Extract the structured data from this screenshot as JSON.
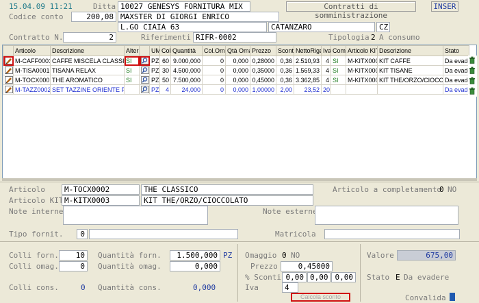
{
  "header": {
    "datetime": "15.04.09 11:21",
    "ditta_label": "Ditta",
    "ditta_value": "10027 GENESYS FORNITURA MIX",
    "contratti_button": "Contratti di somministrazione",
    "mode_badge": "INSER",
    "codice_conto_label": "Codice conto",
    "codice_conto_value": "200,08",
    "cliente_nome": "MAXSTER DI GIORGI ENRICO",
    "indirizzo": "L.GO CIAIA 63",
    "citta": "CATANZARO",
    "provincia": "CZ",
    "contratto_label": "Contratto N.",
    "contratto_value": "2",
    "riferimenti_label": "Riferimenti",
    "riferimenti_value": "RIFR-0002",
    "tipologia_label": "Tipologia",
    "tipologia_value": "2",
    "tipologia_desc": "A consumo"
  },
  "grid": {
    "columns": [
      "Articolo",
      "Descrizione",
      "Alter",
      "UM",
      "Colli",
      "Quantità",
      "Col.Om.",
      "Qtà Omag",
      "Prezzo",
      "Sconti",
      "NettoRiga",
      "Iva",
      "Compl",
      "Articolo KIT",
      "Descrizione",
      "Stato"
    ],
    "rows": [
      {
        "articolo": "M-CAFF0001",
        "descrizione": "CAFFE MISCELA CLASSICA",
        "alter": "SI",
        "um": "PZ",
        "colli": "60",
        "quantita": "9.000,000",
        "col_om": "0",
        "qta_omag": "0,000",
        "prezzo": "0,28000",
        "sconti": "0,36",
        "netto": "2.510,93",
        "iva": "4",
        "compl": "SI",
        "kit": "M-KITX0001",
        "kit_desc": "KIT CAFFE",
        "stato": "Da evadere"
      },
      {
        "articolo": "M-TISA0001",
        "descrizione": "TISANA RELAX",
        "alter": "SI",
        "um": "PZ",
        "colli": "30",
        "quantita": "4.500,000",
        "col_om": "0",
        "qta_omag": "0,000",
        "prezzo": "0,35000",
        "sconti": "0,36",
        "netto": "1.569,33",
        "iva": "4",
        "compl": "SI",
        "kit": "M-KITX0002",
        "kit_desc": "KIT TISANE",
        "stato": "Da evadere"
      },
      {
        "articolo": "M-TOCX0001",
        "descrizione": "THE AROMATICO",
        "alter": "SI",
        "um": "PZ",
        "colli": "50",
        "quantita": "7.500,000",
        "col_om": "0",
        "qta_omag": "0,000",
        "prezzo": "0,45000",
        "sconti": "0,36",
        "netto": "3.362,85",
        "iva": "4",
        "compl": "SI",
        "kit": "M-KITX0003",
        "kit_desc": "KIT THE/ORZO/CIOCCOLATO",
        "stato": "Da evadere"
      },
      {
        "articolo": "M-TAZZ0002",
        "descrizione": "SET TAZZINE ORIENTE PER THE",
        "alter": "",
        "um": "PZ",
        "colli": "4",
        "quantita": "24,000",
        "col_om": "0",
        "qta_omag": "0,000",
        "prezzo": "1,00000",
        "sconti": "2,00",
        "netto": "23,52",
        "iva": "20",
        "compl": "",
        "kit": "",
        "kit_desc": "",
        "stato": "Da evadere"
      }
    ]
  },
  "detail": {
    "articolo_label": "Articolo",
    "articolo_code": "M-TOCX0002",
    "articolo_desc": "THE CLASSICO",
    "completamento_label": "Articolo a completamento",
    "completamento_value": "0",
    "completamento_desc": "NO",
    "kit_label": "Articolo KIT",
    "kit_code": "M-KITX0003",
    "kit_desc": "KIT THE/ORZO/CIOCCOLATO",
    "note_interne_label": "Note interne",
    "note_esterne_label": "Note esterne",
    "tipo_fornit_label": "Tipo fornit.",
    "tipo_fornit_value": "0",
    "matricola_label": "Matricola"
  },
  "quantities": {
    "colli_forn_label": "Colli forn.",
    "colli_forn_value": "10",
    "quantita_forn_label": "Quantità forn.",
    "quantita_forn_value": "1.500,000",
    "quantita_forn_um": "PZ",
    "colli_omag_label": "Colli omag.",
    "colli_omag_value": "0",
    "quantita_omag_label": "Quantità omag.",
    "quantita_omag_value": "0,000",
    "colli_cons_label": "Colli cons.",
    "colli_cons_value": "0",
    "quantita_cons_label": "Quantità cons.",
    "quantita_cons_value": "0,000"
  },
  "pricing": {
    "omaggio_label": "Omaggio",
    "omaggio_value": "0",
    "omaggio_desc": "NO",
    "prezzo_label": "Prezzo",
    "prezzo_value": "0,45000",
    "sconti_label": "% Sconti",
    "sconti_values": [
      "0,00",
      "0,00",
      "0,00",
      "0,00"
    ],
    "iva_label": "Iva",
    "iva_value": "4",
    "calcola_button": "Calcola sconto"
  },
  "summary": {
    "valore_label": "Valore",
    "valore_value": "675,00",
    "stato_label": "Stato",
    "stato_code": "E",
    "stato_desc": "Da evadere",
    "convalida_label": "Convalida"
  },
  "colors": {
    "background": "#ece9d8",
    "accent_blue": "#1f3aa0",
    "highlight_red": "#d01010",
    "green_text": "#1e7a1e"
  }
}
